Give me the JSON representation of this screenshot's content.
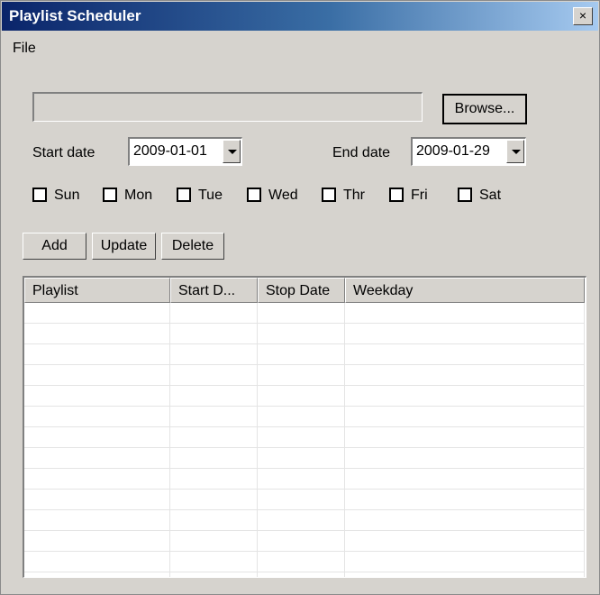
{
  "window": {
    "title": "Playlist Scheduler",
    "close_label": "×"
  },
  "menu": {
    "file": "File"
  },
  "file_picker": {
    "path_value": "",
    "browse_label": "Browse..."
  },
  "dates": {
    "start_label": "Start date",
    "start_value": "2009-01-01",
    "end_label": "End date",
    "end_value": "2009-01-29"
  },
  "weekdays": {
    "sun": {
      "label": "Sun",
      "checked": false
    },
    "mon": {
      "label": "Mon",
      "checked": false
    },
    "tue": {
      "label": "Tue",
      "checked": false
    },
    "wed": {
      "label": "Wed",
      "checked": false
    },
    "thr": {
      "label": "Thr",
      "checked": false
    },
    "fri": {
      "label": "Fri",
      "checked": false
    },
    "sat": {
      "label": "Sat",
      "checked": false
    }
  },
  "actions": {
    "add": "Add",
    "update": "Update",
    "delete": "Delete"
  },
  "table": {
    "columns": [
      "Playlist",
      "Start D...",
      "Stop Date",
      "Weekday"
    ],
    "rows": []
  },
  "colors": {
    "title_gradient_start": "#0a246a",
    "title_gradient_end": "#a6caf0",
    "window_face": "#d6d3ce"
  }
}
